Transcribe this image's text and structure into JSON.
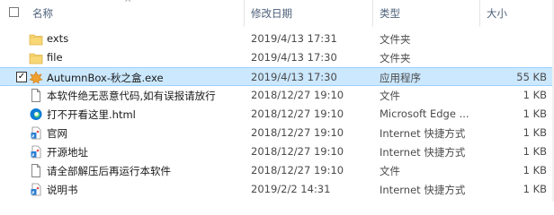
{
  "columns": {
    "name": "名称",
    "date": "修改日期",
    "type": "类型",
    "size": "大小"
  },
  "files": [
    {
      "name": "exts",
      "date": "2019/4/13 17:31",
      "type": "文件夹",
      "size": "",
      "icon": "folder-icon"
    },
    {
      "name": "file",
      "date": "2019/4/13 17:30",
      "type": "文件夹",
      "size": "",
      "icon": "folder-icon"
    },
    {
      "name": "AutumnBox-秋之盒.exe",
      "date": "2019/4/13 17:30",
      "type": "应用程序",
      "size": "55 KB",
      "icon": "autumnbox-app-icon",
      "selected": true,
      "checked": true
    },
    {
      "name": "本软件绝无恶意代码,如有误报请放行",
      "date": "2018/12/27 19:10",
      "type": "文件",
      "size": "1 KB",
      "icon": "file-icon"
    },
    {
      "name": "打不开看这里.html",
      "date": "2018/12/27 19:10",
      "type": "Microsoft Edge ...",
      "size": "1 KB",
      "icon": "edge-icon"
    },
    {
      "name": "官网",
      "date": "2018/12/27 19:10",
      "type": "Internet 快捷方式",
      "size": "1 KB",
      "icon": "internet-shortcut-icon"
    },
    {
      "name": "开源地址",
      "date": "2018/12/27 19:10",
      "type": "Internet 快捷方式",
      "size": "1 KB",
      "icon": "internet-shortcut-icon"
    },
    {
      "name": "请全部解压后再运行本软件",
      "date": "2018/12/27 19:10",
      "type": "文件",
      "size": "1 KB",
      "icon": "file-icon"
    },
    {
      "name": "说明书",
      "date": "2019/2/2 14:31",
      "type": "Internet 快捷方式",
      "size": "1 KB",
      "icon": "internet-shortcut-icon"
    }
  ],
  "colors": {
    "selection": "#cce8ff",
    "selection_border": "#99d1ff",
    "folder": "#f8d775",
    "edge": "#0c7bd6"
  }
}
